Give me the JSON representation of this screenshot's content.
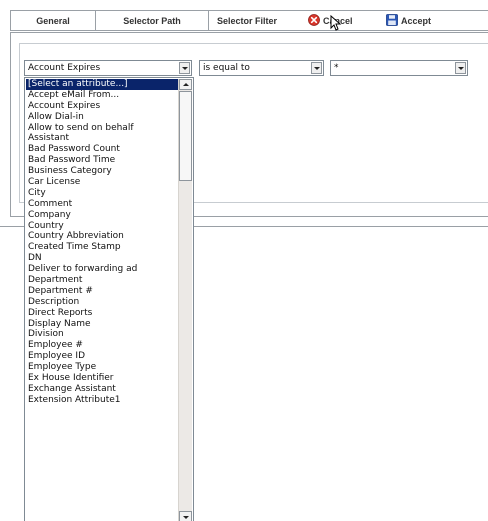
{
  "tabs": {
    "general": "General",
    "selector_path": "Selector Path",
    "selector_filter": "Selector Filter",
    "cancel": "Cancel",
    "accept": "Accept"
  },
  "filter": {
    "attribute_value": "Account Expires",
    "operator_value": "is equal to",
    "value_text": "*"
  },
  "attribute_options": [
    "[Select an attribute...]",
    "Accept eMail From...",
    "Account Expires",
    "Allow Dial-in",
    "Allow to send on behalf",
    "Assistant",
    "Bad Password Count",
    "Bad Password Time",
    "Business Category",
    "Car License",
    "City",
    "Comment",
    "Company",
    "Country",
    "Country Abbreviation",
    "Created Time Stamp",
    "DN",
    "Deliver to forwarding ad",
    "Department",
    "Department #",
    "Description",
    "Direct Reports",
    "Display Name",
    "Division",
    "Employee #",
    "Employee ID",
    "Employee Type",
    "Ex House Identifier",
    "Exchange Assistant",
    "Extension Attribute1"
  ],
  "icons": {
    "cancel": "cancel-icon",
    "accept": "save-icon",
    "cursor": "mouse-cursor-icon"
  },
  "colors": {
    "selected_bg": "#0a246a",
    "cancel_red": "#d9362b",
    "accept_blue": "#2b57b5"
  }
}
